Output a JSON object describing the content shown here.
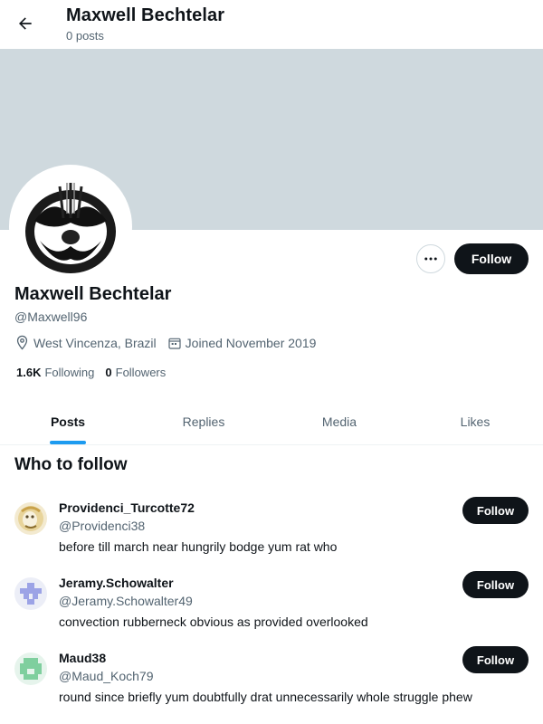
{
  "header": {
    "title": "Maxwell Bechtelar",
    "post_count": "0 posts"
  },
  "profile": {
    "name": "Maxwell Bechtelar",
    "handle": "@Maxwell96",
    "location": "West Vincenza, Brazil",
    "joined": "Joined November 2019",
    "following_count": "1.6K",
    "following_label": "Following",
    "followers_count": "0",
    "followers_label": "Followers",
    "follow_label": "Follow"
  },
  "tabs": [
    {
      "label": "Posts",
      "active": true
    },
    {
      "label": "Replies",
      "active": false
    },
    {
      "label": "Media",
      "active": false
    },
    {
      "label": "Likes",
      "active": false
    }
  ],
  "who_to_follow": {
    "title": "Who to follow",
    "users": [
      {
        "name": "Providenci_Turcotte72",
        "handle": "@Providenci38",
        "bio": "before till march near hungrily bodge yum rat who",
        "follow_label": "Follow"
      },
      {
        "name": "Jeramy.Schowalter",
        "handle": "@Jeramy.Schowalter49",
        "bio": "convection rubberneck obvious as provided overlooked",
        "follow_label": "Follow"
      },
      {
        "name": "Maud38",
        "handle": "@Maud_Koch79",
        "bio": "round since briefly yum doubtfully drat unnecessarily whole struggle phew",
        "follow_label": "Follow"
      }
    ]
  },
  "colors": {
    "banner": "#cfd9de",
    "accent": "#1d9bf0",
    "button": "#0f1419",
    "muted": "#536471"
  },
  "icons": [
    "back-arrow-icon",
    "more-icon",
    "location-icon",
    "calendar-icon"
  ]
}
